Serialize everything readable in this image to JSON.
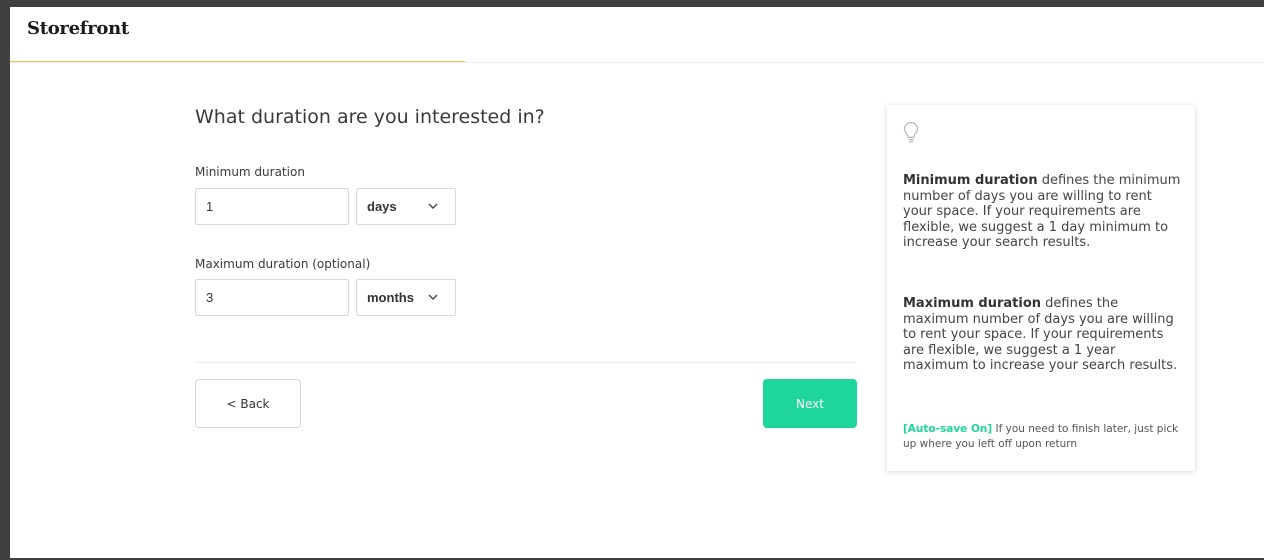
{
  "header": {
    "logo": "Storefront"
  },
  "form": {
    "title": "What duration are you interested in?",
    "minimum": {
      "label": "Minimum duration",
      "value": "1",
      "unit": "days"
    },
    "maximum": {
      "label": "Maximum duration (optional)",
      "value": "3",
      "unit": "months"
    },
    "back_label": "< Back",
    "next_label": "Next"
  },
  "tip": {
    "icon": "lightbulb-icon",
    "min_term": "Minimum duration",
    "min_text": " defines the minimum number of days you are willing to rent your space. If your requirements are flexible, we suggest a 1 day minimum to increase your search results.",
    "max_term": "Maximum duration",
    "max_text": " defines the maximum number of days you are willing to rent your space. If your requirements are flexible, we suggest a 1 year maximum to increase your search results.",
    "autosave_tag": "[Auto-save On]",
    "autosave_text": " If you need to finish later, just pick up where you left off upon return"
  },
  "colors": {
    "accent": "#1ed69c",
    "header_underline": "#f0c850",
    "frame": "#404040"
  }
}
